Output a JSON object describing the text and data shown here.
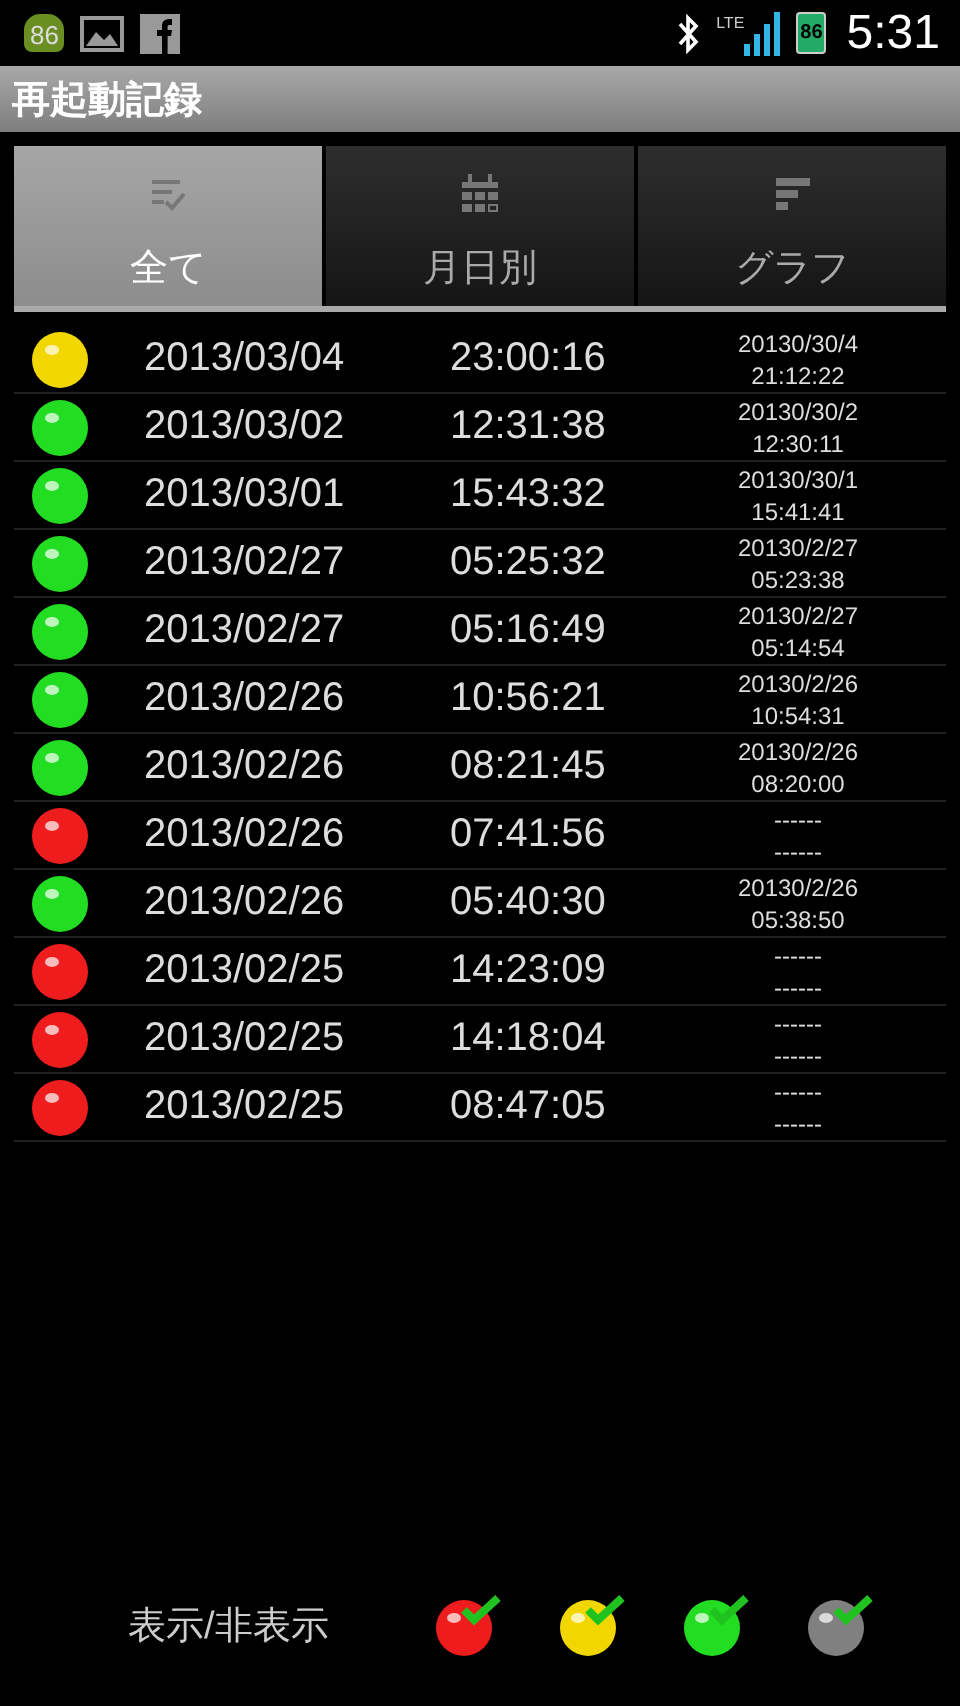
{
  "status_bar": {
    "app_badge": "86",
    "network": "LTE",
    "battery": "86",
    "time": "5:31"
  },
  "title": "再起動記録",
  "tabs": [
    {
      "label": "全て",
      "kind": "list",
      "selected": true
    },
    {
      "label": "月日別",
      "kind": "calendar",
      "selected": false
    },
    {
      "label": "グラフ",
      "kind": "graph",
      "selected": false
    }
  ],
  "rows": [
    {
      "color": "#f2d600",
      "date": "2013/03/04",
      "time": "23:00:16",
      "previous": [
        "20130/30/4",
        "21:12:22"
      ]
    },
    {
      "color": "#22dd22",
      "date": "2013/03/02",
      "time": "12:31:38",
      "previous": [
        "20130/30/2",
        "12:30:11"
      ]
    },
    {
      "color": "#22dd22",
      "date": "2013/03/01",
      "time": "15:43:32",
      "previous": [
        "20130/30/1",
        "15:41:41"
      ]
    },
    {
      "color": "#22dd22",
      "date": "2013/02/27",
      "time": "05:25:32",
      "previous": [
        "20130/2/27",
        "05:23:38"
      ]
    },
    {
      "color": "#22dd22",
      "date": "2013/02/27",
      "time": "05:16:49",
      "previous": [
        "20130/2/27",
        "05:14:54"
      ]
    },
    {
      "color": "#22dd22",
      "date": "2013/02/26",
      "time": "10:56:21",
      "previous": [
        "20130/2/26",
        "10:54:31"
      ]
    },
    {
      "color": "#22dd22",
      "date": "2013/02/26",
      "time": "08:21:45",
      "previous": [
        "20130/2/26",
        "08:20:00"
      ]
    },
    {
      "color": "#ee1c1c",
      "date": "2013/02/26",
      "time": "07:41:56",
      "previous": [
        "------",
        "------"
      ]
    },
    {
      "color": "#22dd22",
      "date": "2013/02/26",
      "time": "05:40:30",
      "previous": [
        "20130/2/26",
        "05:38:50"
      ]
    },
    {
      "color": "#ee1c1c",
      "date": "2013/02/25",
      "time": "14:23:09",
      "previous": [
        "------",
        "------"
      ]
    },
    {
      "color": "#ee1c1c",
      "date": "2013/02/25",
      "time": "14:18:04",
      "previous": [
        "------",
        "------"
      ]
    },
    {
      "color": "#ee1c1c",
      "date": "2013/02/25",
      "time": "08:47:05",
      "previous": [
        "------",
        "------"
      ]
    }
  ],
  "filter": {
    "label": "表示/非表示",
    "toggles": [
      {
        "color": "#ee1c1c",
        "checked": true
      },
      {
        "color": "#f2d600",
        "checked": true
      },
      {
        "color": "#22dd22",
        "checked": true
      },
      {
        "color": "#808080",
        "checked": true
      }
    ]
  }
}
